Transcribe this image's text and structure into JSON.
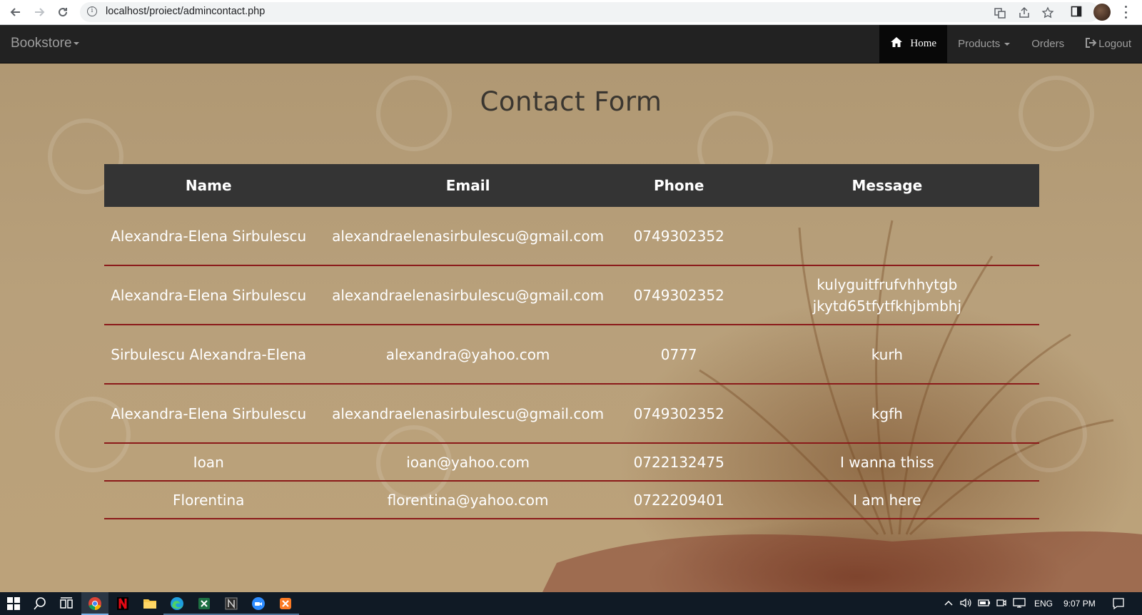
{
  "browser": {
    "url": "localhost/proiect/admincontact.php"
  },
  "navbar": {
    "brand": "Bookstore",
    "items": [
      {
        "label": "Home",
        "icon": "home-icon",
        "active": true
      },
      {
        "label": "Products",
        "icon": "caret-down-icon",
        "active": false
      },
      {
        "label": "Orders",
        "active": false
      },
      {
        "label": "Logout",
        "icon": "logout-icon",
        "active": false
      }
    ]
  },
  "main": {
    "title": "Contact Form",
    "table": {
      "headers": [
        "Name",
        "Email",
        "Phone",
        "Message"
      ],
      "rows": [
        {
          "name": "Alexandra-Elena Sirbulescu",
          "email": "alexandraelenasirbulescu@gmail.com",
          "phone": "0749302352",
          "message": ""
        },
        {
          "name": "Alexandra-Elena Sirbulescu",
          "email": "alexandraelenasirbulescu@gmail.com",
          "phone": "0749302352",
          "message": "kulyguitfrufvhhytgb jkytd65tfytfkhjbmbhj"
        },
        {
          "name": "Sirbulescu Alexandra-Elena",
          "email": "alexandra@yahoo.com",
          "phone": "0777",
          "message": "kurh"
        },
        {
          "name": "Alexandra-Elena Sirbulescu",
          "email": "alexandraelenasirbulescu@gmail.com",
          "phone": "0749302352",
          "message": "kgfh"
        },
        {
          "name": "Ioan",
          "email": "ioan@yahoo.com",
          "phone": "0722132475",
          "message": "I wanna thiss"
        },
        {
          "name": "Florentina",
          "email": "florentina@yahoo.com",
          "phone": "0722209401",
          "message": "I am here"
        }
      ]
    }
  },
  "taskbar": {
    "apps": [
      "windows-start-icon",
      "search-icon",
      "task-view-icon",
      "chrome-icon",
      "netflix-icon",
      "file-explorer-icon",
      "edge-icon",
      "excel-icon",
      "notion-icon",
      "zoom-icon",
      "xampp-icon"
    ],
    "language": "ENG",
    "time": "9:07 PM"
  },
  "colors": {
    "navbar_bg": "#222222",
    "table_header_bg": "#343434",
    "row_border": "#8b1a1a",
    "title": "#3a3630"
  }
}
